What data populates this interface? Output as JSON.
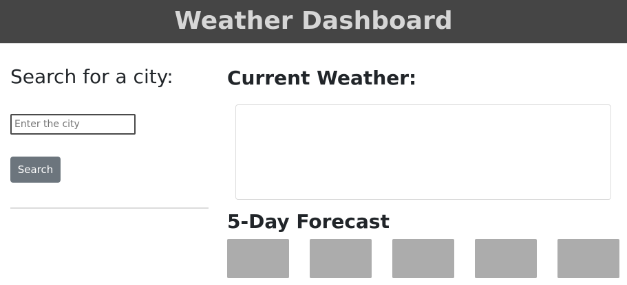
{
  "header": {
    "title": "Weather Dashboard"
  },
  "search": {
    "heading": "Search for a city:",
    "placeholder": "Enter the city",
    "button_label": "Search"
  },
  "current": {
    "heading": "Current Weather:"
  },
  "forecast": {
    "heading": "5-Day Forecast",
    "days": [
      "",
      "",
      "",
      "",
      ""
    ]
  },
  "colors": {
    "header_bg": "#454545",
    "header_text": "#d6d6d6",
    "button_bg": "#6c757d",
    "forecast_card_bg": "#acacac"
  }
}
